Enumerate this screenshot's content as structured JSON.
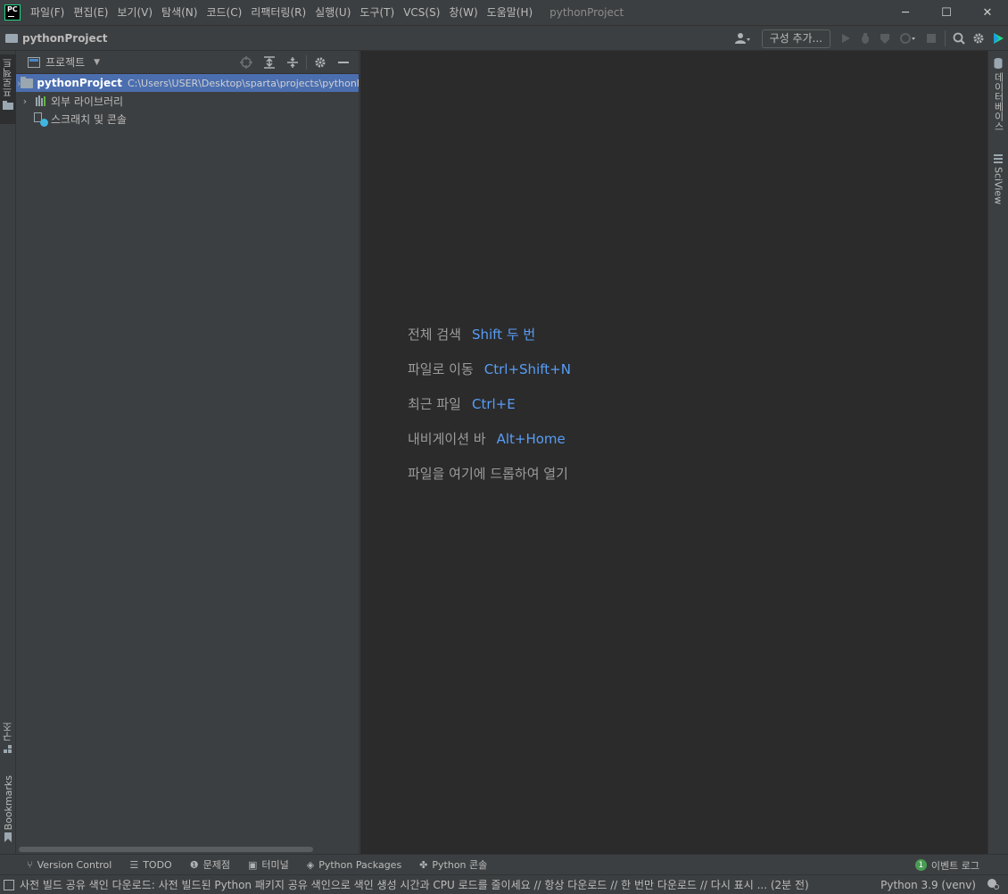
{
  "titlebar": {
    "logo_text": "PC",
    "menu": [
      "파일(F)",
      "편집(E)",
      "보기(V)",
      "탐색(N)",
      "코드(C)",
      "리팩터링(R)",
      "실행(U)",
      "도구(T)",
      "VCS(S)",
      "창(W)",
      "도움말(H)"
    ],
    "window_title": "pythonProject",
    "minimize": "─",
    "maximize": "☐",
    "close": "✕"
  },
  "navbar": {
    "project_name": "pythonProject",
    "add_config_label": "구성 추가...",
    "icons": [
      "user-icon",
      "run-icon",
      "debug-icon",
      "coverage-icon",
      "profile-icon",
      "stop-icon",
      "search-icon",
      "gear-icon",
      "logo-icon"
    ]
  },
  "left_strip": {
    "project_tab": "프로젝트",
    "structure_tab": "구조",
    "bookmarks_tab": "Bookmarks"
  },
  "project_panel": {
    "title": "프로젝트",
    "tree": [
      {
        "label": "pythonProject",
        "path": "C:\\Users\\USER\\Desktop\\sparta\\projects\\pythonProject",
        "selected": true
      },
      {
        "label": "외부 라이브러리"
      },
      {
        "label": "스크래치 및 콘솔"
      }
    ]
  },
  "editor": {
    "hints": [
      {
        "label": "전체 검색",
        "key": "Shift 두 번"
      },
      {
        "label": "파일로 이동",
        "key": "Ctrl+Shift+N"
      },
      {
        "label": "최근 파일",
        "key": "Ctrl+E"
      },
      {
        "label": "내비게이션 바",
        "key": "Alt+Home"
      },
      {
        "label": "파일을 여기에 드롭하여 열기",
        "key": ""
      }
    ]
  },
  "right_strip": {
    "database_tab": "데이터베이스",
    "sciview_tab": "SciView"
  },
  "bottom_tabs": {
    "version_control": "Version Control",
    "todo": "TODO",
    "problems": "문제점",
    "terminal": "터미널",
    "python_packages": "Python Packages",
    "python_console": "Python 콘솔",
    "event_log": "이벤트 로그",
    "event_count": "1"
  },
  "statusbar": {
    "message": "사전 빌드 공유 색인 다운로드: 사전 빌드된 Python 패키지 공유 색인으로 색인 생성 시간과 CPU 로드를 줄이세요 // 항상 다운로드 // 한 번만 다운로드 // 다시 표시 ... (2분 전)",
    "interpreter": "Python 3.9 (venv)"
  }
}
